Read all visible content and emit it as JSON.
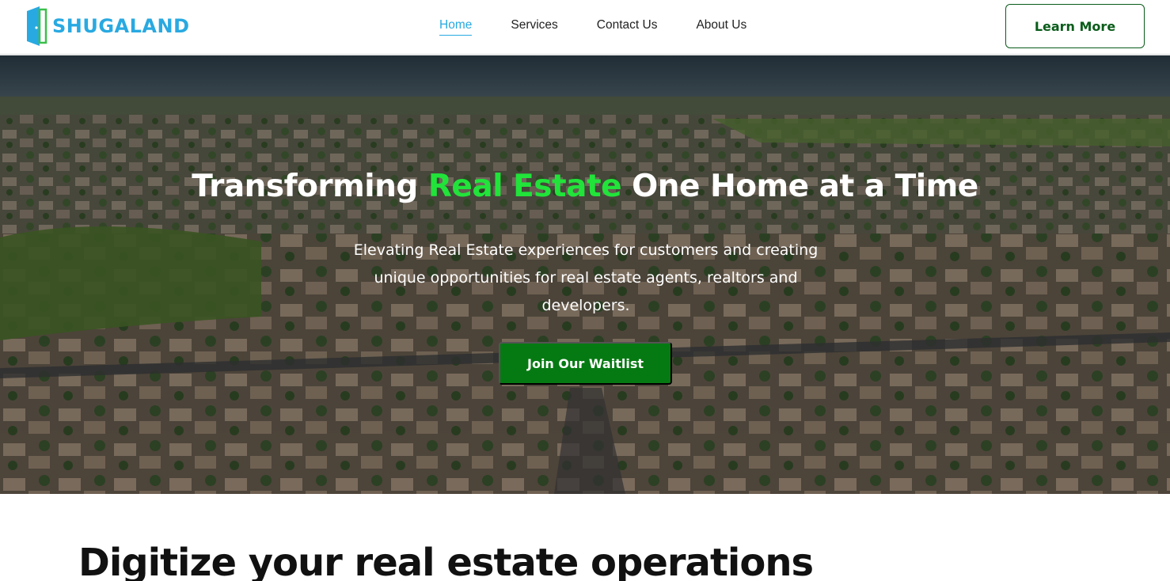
{
  "navbar": {
    "logo_text": "SHUGALAND",
    "links": [
      {
        "label": "Home",
        "active": true
      },
      {
        "label": "Services",
        "active": false
      },
      {
        "label": "Contact Us",
        "active": false
      },
      {
        "label": "About Us",
        "active": false
      }
    ],
    "cta_label": "Learn More"
  },
  "hero": {
    "title_before": "Transforming ",
    "title_accent": "Real Estate",
    "title_after": " One Home at a Time",
    "subtitle": "Elevating Real Estate experiences for customers and creating unique opportunities for real estate agents, realtors and developers.",
    "cta_label": "Join Our Waitlist"
  },
  "section": {
    "heading": "Digitize your real estate operations"
  },
  "colors": {
    "brand_blue": "#29a9e1",
    "accent_green": "#21e33a",
    "button_green": "#067a12",
    "outline_green": "#0a5c1a"
  },
  "icons": {
    "logo": "door-icon"
  }
}
